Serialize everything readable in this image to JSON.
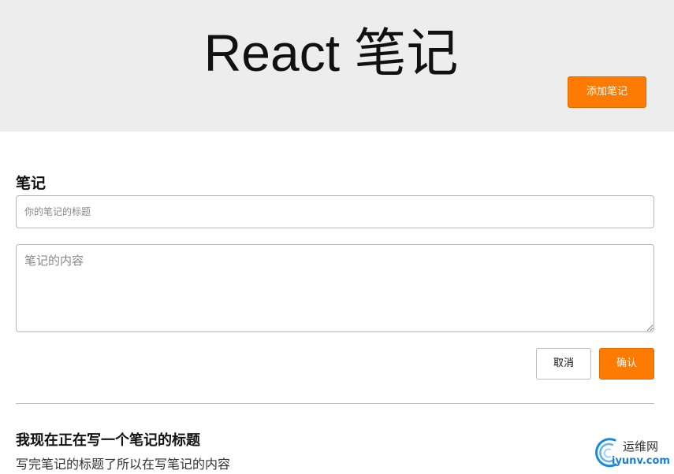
{
  "header": {
    "title": "React 笔记",
    "add_button_label": "添加笔记"
  },
  "form": {
    "section_label": "笔记",
    "title_placeholder": "你的笔记的标题",
    "content_placeholder": "笔记的内容",
    "cancel_label": "取消",
    "confirm_label": "确认"
  },
  "notes": [
    {
      "title": "我现在正在写一个笔记的标题",
      "content": "写完笔记的标题了所以在写笔记的内容"
    }
  ],
  "watermark": {
    "name": "运维网",
    "url": "iyunv.com"
  },
  "colors": {
    "accent": "#ff7a00",
    "header_bg": "#ededed"
  }
}
